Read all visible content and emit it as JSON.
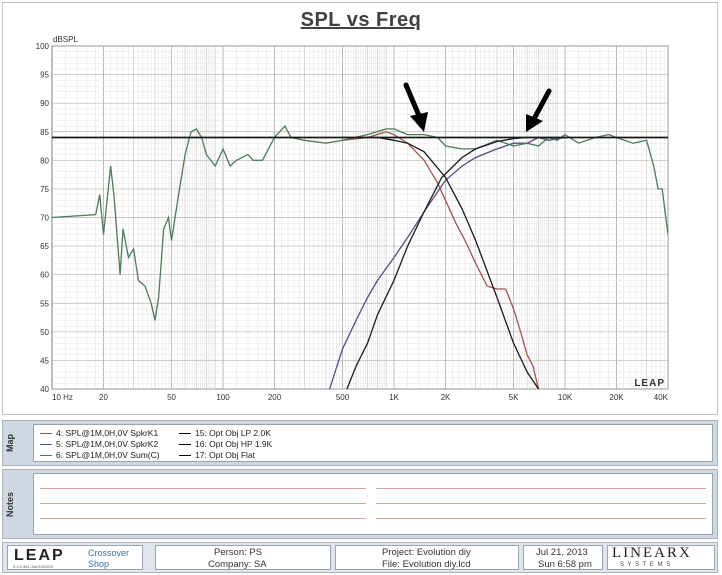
{
  "chart": {
    "title": "SPL vs Freq",
    "y_unit_label": "dBSPL",
    "watermark": "LEAP"
  },
  "chart_data": {
    "type": "line",
    "title": "SPL vs Freq",
    "xlabel": "",
    "ylabel": "dBSPL",
    "x_scale": "log",
    "xlim": [
      10,
      40000
    ],
    "ylim": [
      40,
      100
    ],
    "grid": true,
    "x_ticks": [
      {
        "value": 10,
        "label": "10 Hz"
      },
      {
        "value": 20,
        "label": "20"
      },
      {
        "value": 50,
        "label": "50"
      },
      {
        "value": 100,
        "label": "100"
      },
      {
        "value": 200,
        "label": "200"
      },
      {
        "value": 500,
        "label": "500"
      },
      {
        "value": 1000,
        "label": "1K"
      },
      {
        "value": 2000,
        "label": "2K"
      },
      {
        "value": 5000,
        "label": "5K"
      },
      {
        "value": 10000,
        "label": "10K"
      },
      {
        "value": 20000,
        "label": "20K"
      },
      {
        "value": 40000,
        "label": "40K"
      }
    ],
    "y_ticks": [
      40,
      45,
      50,
      55,
      60,
      65,
      70,
      75,
      80,
      85,
      90,
      95,
      100
    ],
    "series": [
      {
        "name": "4: SPL@1M,0H,0V SpkrK1",
        "color": "#a0584c",
        "x": [
          500,
          700,
          900,
          1000,
          1200,
          1500,
          1800,
          2000,
          2300,
          2600,
          3000,
          3500,
          4000,
          4500,
          5000,
          5500,
          6000,
          6500,
          7000
        ],
        "y": [
          83.5,
          84,
          85,
          84.5,
          83,
          80,
          76,
          73,
          69,
          66,
          62,
          58,
          57.5,
          57.5,
          54,
          50,
          46,
          44,
          40
        ]
      },
      {
        "name": "5: SPL@1M,0H,0V SpkrK2",
        "color": "#5a4b86",
        "x": [
          420,
          500,
          600,
          700,
          800,
          1000,
          1200,
          1500,
          1800,
          2000,
          2500,
          3000,
          4000,
          5000,
          6000,
          7000,
          8000,
          10000
        ],
        "y": [
          40,
          47,
          52,
          56,
          59,
          63,
          66.5,
          71,
          74.5,
          76.5,
          79,
          80.5,
          82,
          83,
          83,
          84,
          83.5,
          84
        ]
      },
      {
        "name": "6: SPL@1M,0H,0V Sum(C)",
        "color": "#4e7a5c",
        "x": [
          10,
          18,
          19,
          20,
          21,
          22,
          23,
          25,
          26,
          28,
          30,
          32,
          35,
          38,
          40,
          42,
          45,
          48,
          50,
          55,
          60,
          65,
          70,
          75,
          80,
          90,
          100,
          110,
          120,
          140,
          150,
          170,
          200,
          230,
          250,
          300,
          400,
          500,
          700,
          900,
          1000,
          1200,
          1500,
          1800,
          2000,
          2500,
          3000,
          4000,
          5000,
          6000,
          7000,
          8000,
          9000,
          10000,
          12000,
          15000,
          18000,
          20000,
          25000,
          30000,
          33000,
          35000,
          37000,
          40000
        ],
        "y": [
          70,
          70.5,
          74,
          67,
          73,
          79,
          74,
          60,
          68,
          63,
          64.5,
          59,
          58,
          55,
          52,
          56,
          68,
          70,
          66,
          74,
          81,
          85,
          85.5,
          84,
          81,
          79,
          82,
          79,
          80,
          81,
          80,
          80,
          84,
          86,
          84,
          83.5,
          83,
          83.5,
          84.5,
          85.5,
          85.5,
          84.5,
          84.5,
          84,
          82.5,
          82,
          82,
          83.5,
          82.5,
          83,
          82.5,
          84,
          83.5,
          84.5,
          83,
          84,
          84.5,
          84,
          83,
          83.5,
          79,
          75,
          75,
          67
        ]
      },
      {
        "name": "15: Opt Obj LP 2.0K",
        "color": "#1a1a1a",
        "x": [
          500,
          800,
          1000,
          1200,
          1500,
          2000,
          2500,
          3000,
          4000,
          5000,
          6000,
          7000,
          7500
        ],
        "y": [
          84,
          84,
          83.5,
          83,
          81.5,
          77,
          71.5,
          66,
          56,
          48,
          43,
          40,
          38
        ]
      },
      {
        "name": "16: Opt Obj HP 1.9K",
        "color": "#1a1a1a",
        "x": [
          530,
          600,
          700,
          800,
          1000,
          1200,
          1500,
          1900,
          2500,
          3000,
          4000,
          5000,
          6000,
          8000,
          10000
        ],
        "y": [
          40,
          44,
          48,
          53,
          59,
          65,
          71,
          77,
          80.5,
          82,
          83.3,
          83.8,
          84,
          84,
          84
        ]
      },
      {
        "name": "17: Opt Obj Flat",
        "color": "#1a1a1a",
        "x": [
          10,
          40000
        ],
        "y": [
          84,
          84
        ]
      }
    ],
    "legend_placement": "below"
  },
  "legend": {
    "side_label": "Map",
    "items": [
      {
        "label": "4: SPL@1M,0H,0V SpkrK1",
        "color": "#a0584c"
      },
      {
        "label": "5: SPL@1M,0H,0V SpkrK2",
        "color": "#5a4b86"
      },
      {
        "label": "6: SPL@1M,0H,0V Sum(C)",
        "color": "#4e7a5c"
      },
      {
        "label": "15: Opt Obj LP   2.0K",
        "color": "#1a1a1a"
      },
      {
        "label": "16: Opt Obj HP   1.9K",
        "color": "#1a1a1a"
      },
      {
        "label": "17: Opt Obj Flat",
        "color": "#1a1a1a"
      }
    ]
  },
  "notes": {
    "side_label": "Notes"
  },
  "footer": {
    "logo": "LEAP",
    "logo_sub": "5.2.0.351 Jan/10/2003",
    "module_line1": "Crossover",
    "module_line2": "Shop",
    "person": "Person: PS",
    "company": "Company: SA",
    "project": "Project: Evolution diy",
    "file": "File: Evolution diy.lcd",
    "date": "Jul 21, 2013",
    "time": "Sun  6:58 pm",
    "brand_logo": "LINEARX",
    "brand_sub": "S Y S T E M S"
  }
}
